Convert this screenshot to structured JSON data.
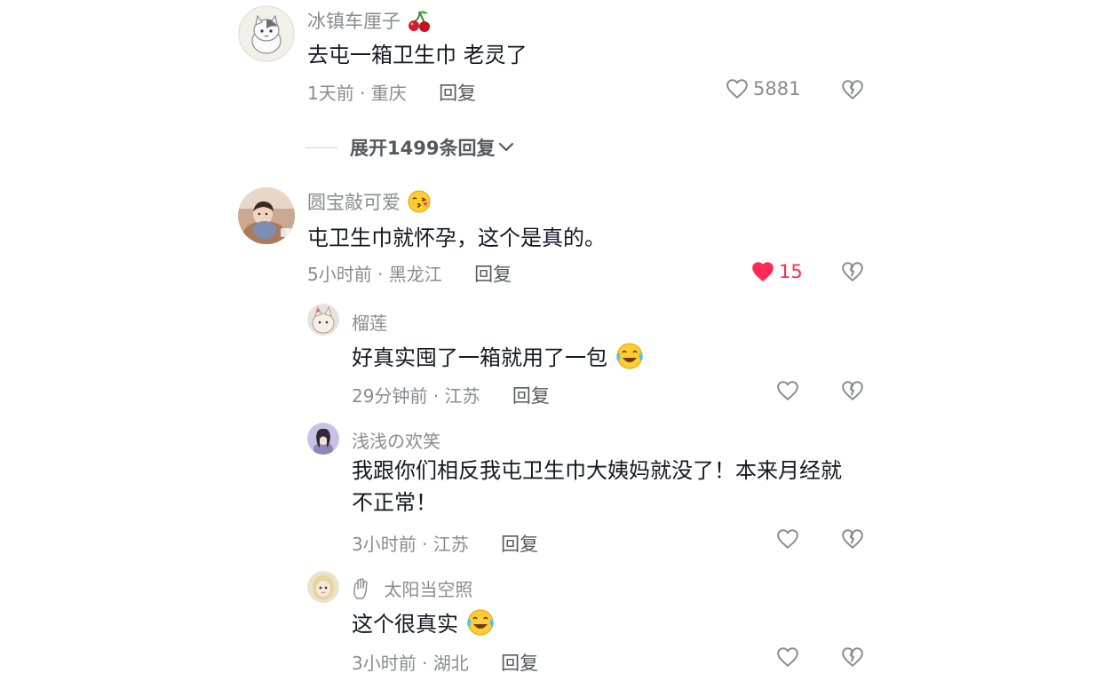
{
  "comments": [
    {
      "username": "冰镇车厘子",
      "text": "去屯一箱卫生巾 老灵了",
      "time_location": "1天前 · 重庆",
      "reply_label": "回复",
      "likes": "5881",
      "liked": false,
      "expand_label": "展开1499条回复"
    },
    {
      "username": "圆宝敲可爱",
      "text": "屯卫生巾就怀孕，这个是真的。",
      "time_location": "5小时前 · 黑龙江",
      "reply_label": "回复",
      "likes": "15",
      "liked": true
    }
  ],
  "replies": [
    {
      "username": "榴莲",
      "text": "好真实囤了一箱就用了一包",
      "time_location": "29分钟前 · 江苏",
      "reply_label": "回复"
    },
    {
      "username": "浅浅の欢笑",
      "text": "我跟你们相反我屯卫生巾大姨妈就没了！本来月经就不正常！",
      "time_location": "3小时前 · 江苏",
      "reply_label": "回复"
    },
    {
      "username": "太阳当空照",
      "text": "这个很真实",
      "time_location": "3小时前 · 湖北",
      "reply_label": "回复"
    }
  ],
  "colors": {
    "text_primary": "#161823",
    "text_secondary": "#8a8b91",
    "like_active": "#fe2c55"
  },
  "icons": [
    "heart-icon",
    "heart-filled-icon",
    "broken-heart-icon",
    "chevron-down-icon",
    "cherry-emoji",
    "kiss-emoji",
    "crying-laughing-emoji",
    "hand-icon"
  ]
}
